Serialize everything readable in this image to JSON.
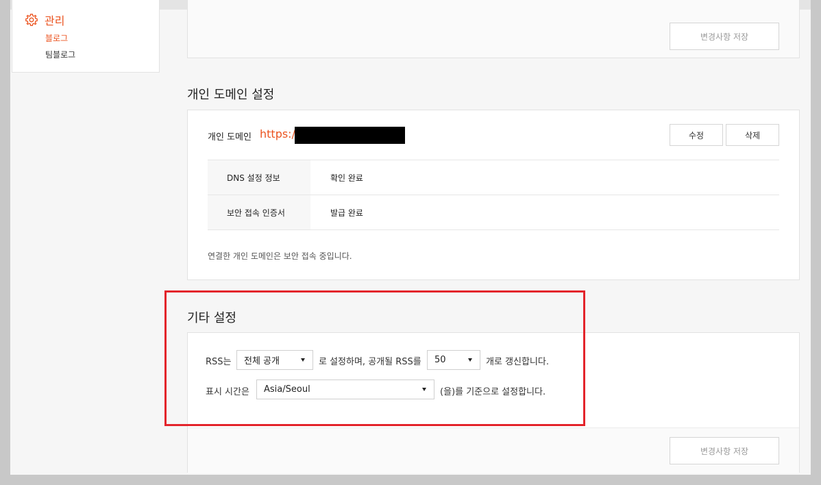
{
  "sidebar": {
    "section_title": "관리",
    "items": [
      {
        "label": "블로그",
        "active": true
      },
      {
        "label": "팀블로그",
        "active": false
      }
    ]
  },
  "top_card": {
    "save_button": "변경사항 저장"
  },
  "domain_section": {
    "title": "개인 도메인 설정",
    "label": "개인 도메인",
    "url_prefix": "https://",
    "edit_button": "수정",
    "delete_button": "삭제",
    "rows": [
      {
        "key": "DNS 설정 정보",
        "value": "확인 완료"
      },
      {
        "key": "보안 접속 인증서",
        "value": "발급 완료"
      }
    ],
    "note": "연결한 개인 도메인은 보안 접속 중입니다."
  },
  "etc_section": {
    "title": "기타 설정",
    "rss_prefix": "RSS는",
    "rss_visibility": "전체 공개",
    "rss_middle": "로 설정하며, 공개될 RSS를",
    "rss_count": "50",
    "rss_suffix": "개로 갱신합니다.",
    "tz_prefix": "표시 시간은",
    "timezone": "Asia/Seoul",
    "tz_suffix": "(을)를 기준으로 설정합니다.",
    "save_button": "변경사항 저장"
  },
  "colors": {
    "accent": "#eb531f",
    "highlight_border": "#e3242b"
  }
}
